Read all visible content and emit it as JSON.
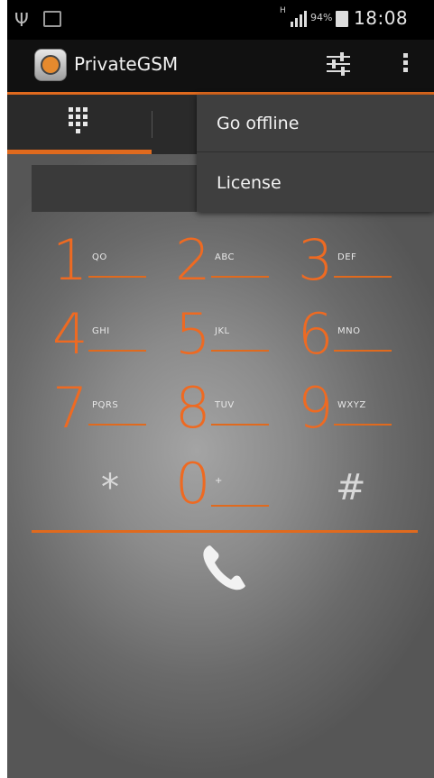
{
  "status_bar": {
    "battery_percent": "94%",
    "network": "H",
    "time": "18:08"
  },
  "app": {
    "title": "PrivateGSM"
  },
  "menu": {
    "items": [
      "Go offline",
      "License"
    ]
  },
  "keypad": {
    "keys": [
      {
        "digit": "1",
        "letters": "QO"
      },
      {
        "digit": "2",
        "letters": "ABC"
      },
      {
        "digit": "3",
        "letters": "DEF"
      },
      {
        "digit": "4",
        "letters": "GHI"
      },
      {
        "digit": "5",
        "letters": "JKL"
      },
      {
        "digit": "6",
        "letters": "MNO"
      },
      {
        "digit": "7",
        "letters": "PQRS"
      },
      {
        "digit": "8",
        "letters": "TUV"
      },
      {
        "digit": "9",
        "letters": "WXYZ"
      },
      {
        "digit": "0",
        "letters": "+"
      }
    ],
    "star": "*",
    "hash": "#"
  },
  "colors": {
    "accent": "#e06a1e",
    "digit": "#ee6a22",
    "action_bar": "#111111"
  },
  "icons": [
    "usb-icon",
    "notification-icon",
    "signal-icon",
    "battery-icon",
    "app-icon",
    "settings-sliders-icon",
    "overflow-menu-icon",
    "dialpad-icon",
    "phone-icon"
  ]
}
